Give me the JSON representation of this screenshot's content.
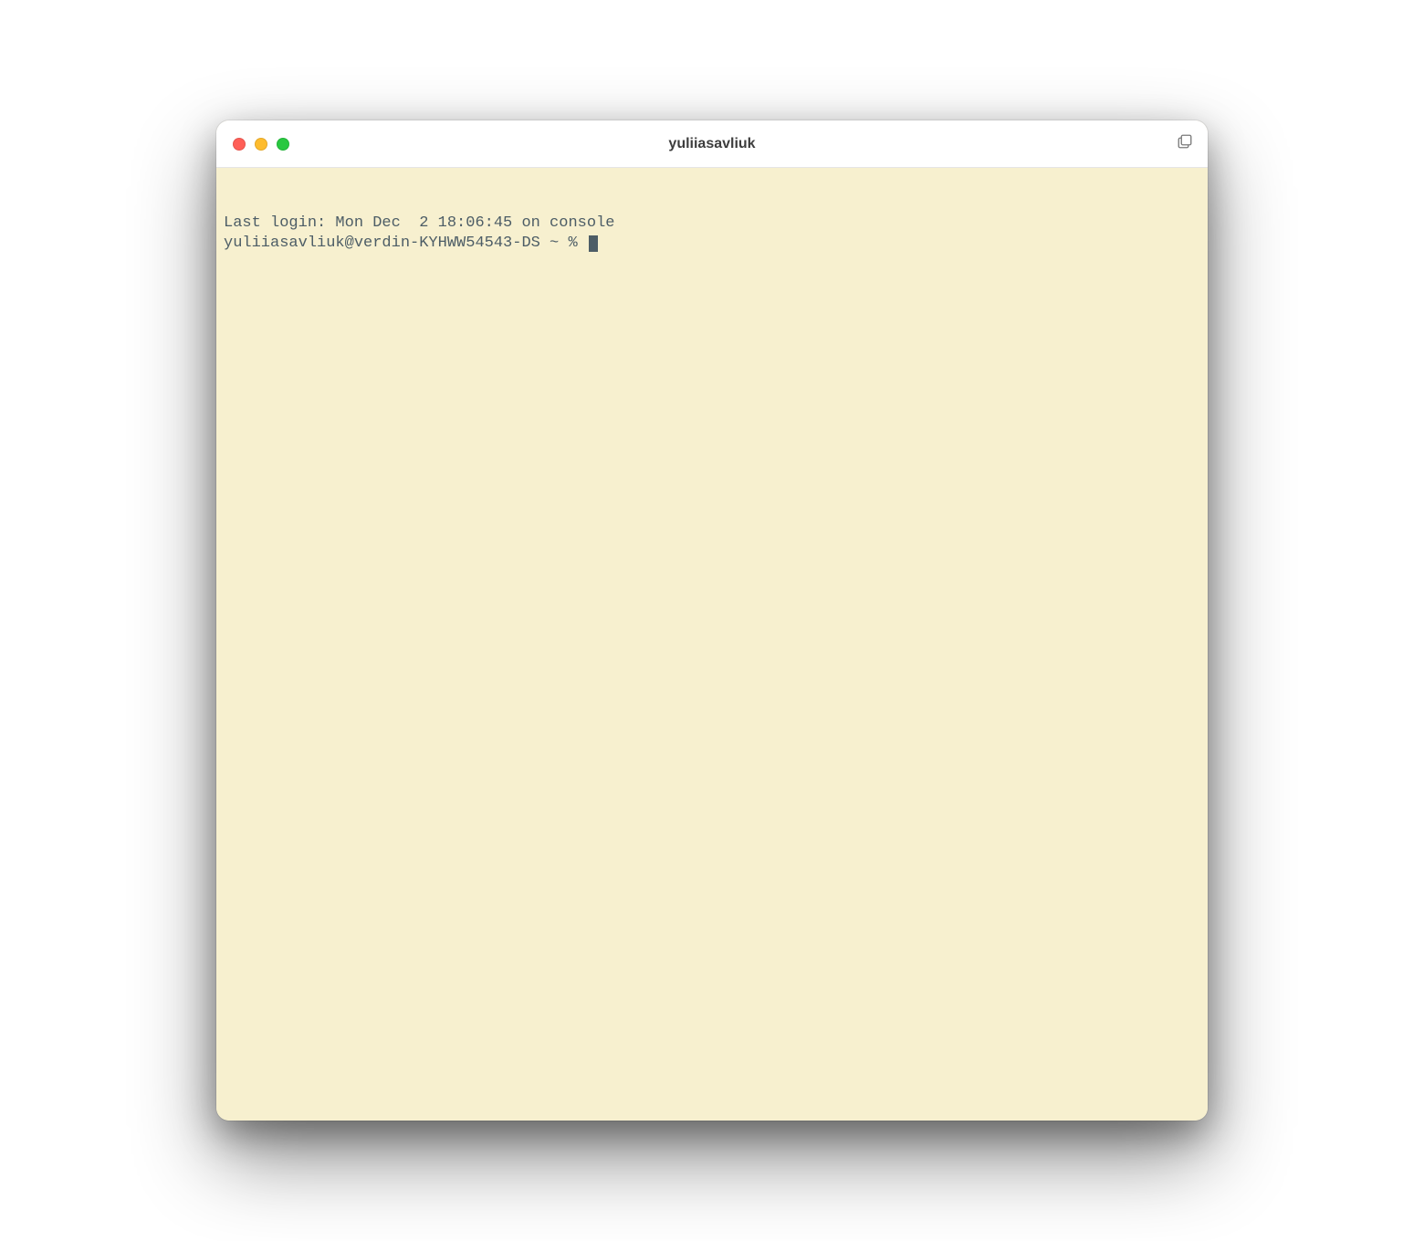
{
  "window": {
    "title": "yuliiasavliuk"
  },
  "terminal": {
    "last_login": "Last login: Mon Dec  2 18:06:45 on console",
    "prompt": "yuliiasavliuk@verdin-KYHWW54543-DS ~ % "
  }
}
